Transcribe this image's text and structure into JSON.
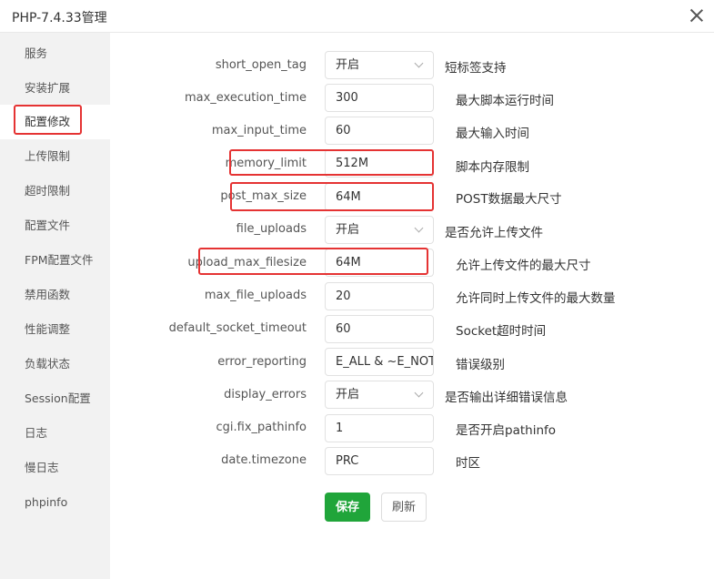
{
  "window": {
    "title": "PHP-7.4.33管理"
  },
  "sidebar": {
    "items": [
      {
        "label": "服务"
      },
      {
        "label": "安装扩展"
      },
      {
        "label": "配置修改"
      },
      {
        "label": "上传限制"
      },
      {
        "label": "超时限制"
      },
      {
        "label": "配置文件"
      },
      {
        "label": "FPM配置文件"
      },
      {
        "label": "禁用函数"
      },
      {
        "label": "性能调整"
      },
      {
        "label": "负载状态"
      },
      {
        "label": "Session配置"
      },
      {
        "label": "日志"
      },
      {
        "label": "慢日志"
      },
      {
        "label": "phpinfo"
      }
    ],
    "active": "配置修改"
  },
  "config": {
    "rows": [
      {
        "key": "short_open_tag",
        "type": "select",
        "value": "开启",
        "desc": "短标签支持"
      },
      {
        "key": "max_execution_time",
        "type": "input",
        "value": "300",
        "desc": "最大脚本运行时间"
      },
      {
        "key": "max_input_time",
        "type": "input",
        "value": "60",
        "desc": "最大输入时间"
      },
      {
        "key": "memory_limit",
        "type": "input",
        "value": "512M",
        "desc": "脚本内存限制"
      },
      {
        "key": "post_max_size",
        "type": "input",
        "value": "64M",
        "desc": "POST数据最大尺寸"
      },
      {
        "key": "file_uploads",
        "type": "select",
        "value": "开启",
        "desc": "是否允许上传文件"
      },
      {
        "key": "upload_max_filesize",
        "type": "input",
        "value": "64M",
        "desc": "允许上传文件的最大尺寸"
      },
      {
        "key": "max_file_uploads",
        "type": "input",
        "value": "20",
        "desc": "允许同时上传文件的最大数量"
      },
      {
        "key": "default_socket_timeout",
        "type": "input",
        "value": "60",
        "desc": "Socket超时时间"
      },
      {
        "key": "error_reporting",
        "type": "input",
        "value": "E_ALL & ~E_NOTICE",
        "desc": "错误级别"
      },
      {
        "key": "display_errors",
        "type": "select",
        "value": "开启",
        "desc": "是否输出详细错误信息"
      },
      {
        "key": "cgi.fix_pathinfo",
        "type": "input",
        "value": "1",
        "desc": "是否开启pathinfo"
      },
      {
        "key": "date.timezone",
        "type": "input",
        "value": "PRC",
        "desc": "时区"
      }
    ]
  },
  "actions": {
    "save_label": "保存",
    "refresh_label": "刷新"
  },
  "colors": {
    "accent": "#20a53a",
    "highlight": "#e53333"
  },
  "icons": {
    "close": "close-icon",
    "dropdown": "chevron-down-icon"
  }
}
